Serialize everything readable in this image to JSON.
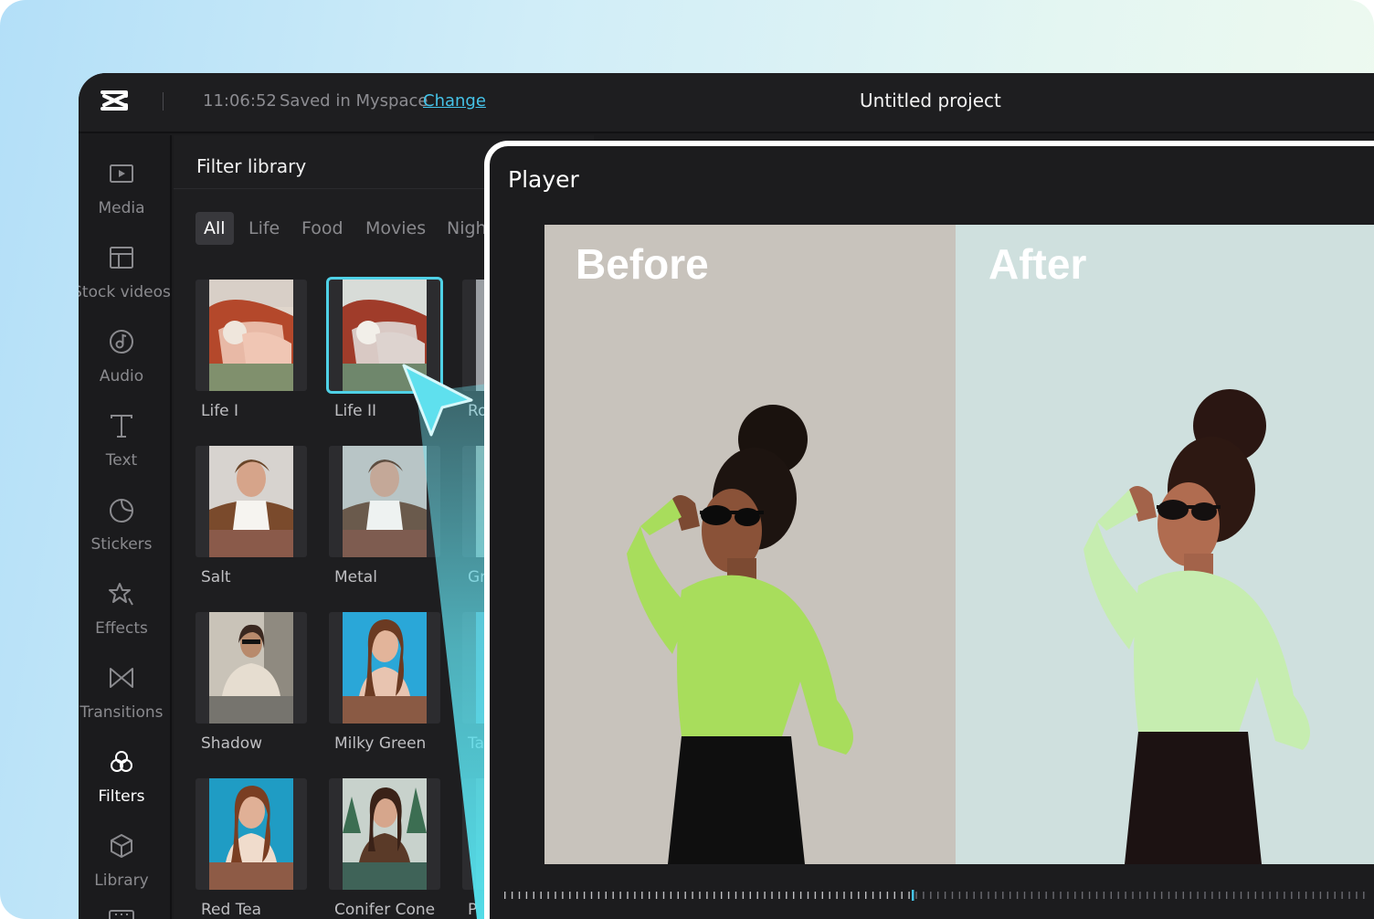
{
  "topbar": {
    "time": "11:06:52",
    "saved": "Saved in Myspace",
    "change_link": "Change",
    "project_title": "Untitled project"
  },
  "sidebar": {
    "items": [
      {
        "label": "Media",
        "icon": "media-icon"
      },
      {
        "label": "Stock videos",
        "icon": "stock-videos-icon"
      },
      {
        "label": "Audio",
        "icon": "audio-icon"
      },
      {
        "label": "Text",
        "icon": "text-icon"
      },
      {
        "label": "Stickers",
        "icon": "stickers-icon"
      },
      {
        "label": "Effects",
        "icon": "effects-icon"
      },
      {
        "label": "Transitions",
        "icon": "transitions-icon"
      },
      {
        "label": "Filters",
        "icon": "filters-icon",
        "active": true
      },
      {
        "label": "Library",
        "icon": "library-icon"
      }
    ]
  },
  "filter_library": {
    "title": "Filter library",
    "tabs": [
      "All",
      "Life",
      "Food",
      "Movies",
      "Nigh"
    ],
    "active_tab": "All",
    "filters": [
      {
        "label": "Life I"
      },
      {
        "label": "Life II",
        "selected": true
      },
      {
        "label": "Ro"
      },
      {
        "label": "Salt"
      },
      {
        "label": "Metal"
      },
      {
        "label": "Gr"
      },
      {
        "label": "Shadow"
      },
      {
        "label": "Milky Green"
      },
      {
        "label": "Ta"
      },
      {
        "label": "Red Tea"
      },
      {
        "label": "Conifer Cone"
      },
      {
        "label": "P"
      }
    ]
  },
  "player": {
    "title": "Player",
    "before_label": "Before",
    "after_label": "After"
  },
  "colors": {
    "accent": "#4fd1e6",
    "link": "#45c3e8",
    "app_bg": "#1b1b1d"
  }
}
